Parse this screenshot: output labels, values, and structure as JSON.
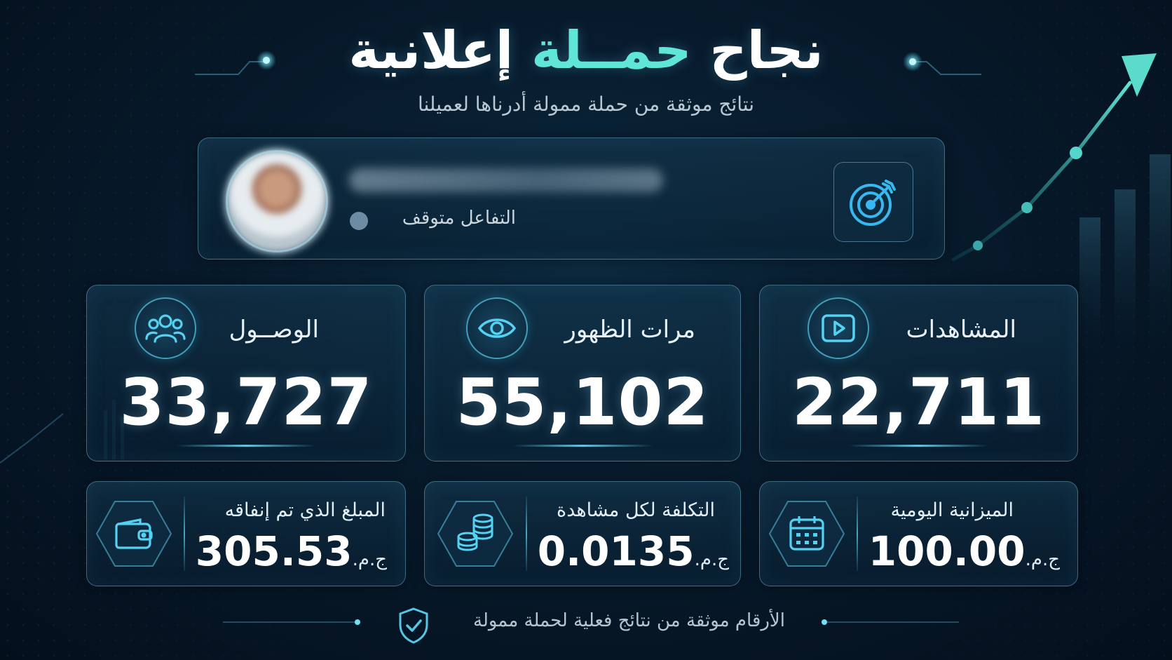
{
  "header": {
    "title_part1": "نجاح ",
    "title_accent": "حمــلة",
    "title_part2": " إعلانية",
    "subtitle": "نتائج موثقة من حملة ممولة أدرناها لعميلنا"
  },
  "profile": {
    "status_text": "التفاعل متوقف",
    "status_color": "#6d8ca3"
  },
  "stats": [
    {
      "label": "المشاهدات",
      "value": "22,711",
      "icon": "play-icon"
    },
    {
      "label": "مرات الظهور",
      "value": "55,102",
      "icon": "eye-icon"
    },
    {
      "label": "الوصــول",
      "value": "33,727",
      "icon": "users-icon"
    }
  ],
  "money": [
    {
      "label": "الميزانية اليومية",
      "value": "100.00",
      "currency": "ج.م.",
      "icon": "calendar-icon"
    },
    {
      "label": "التكلفة لكل مشاهدة",
      "value": "0.0135",
      "currency": "ج.م.",
      "icon": "coins-icon"
    },
    {
      "label": "المبلغ الذي تم إنفاقه",
      "value": "305.53",
      "currency": "ج.م.",
      "icon": "wallet-icon"
    }
  ],
  "footer": {
    "text": "الأرقام موثقة من نتائج فعلية لحملة ممولة"
  },
  "colors": {
    "accent": "#5fe6d6",
    "icon_cyan": "#38c8f0",
    "background": "#071a2b"
  }
}
